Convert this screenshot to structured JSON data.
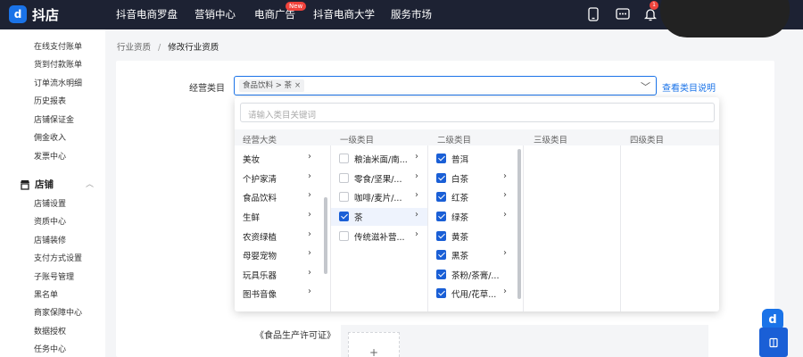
{
  "topnav": {
    "brand": "抖店",
    "items": [
      "抖音电商罗盘",
      "营销中心",
      "电商广告",
      "抖音电商大学",
      "服务市场"
    ],
    "new_badge": "New",
    "notify_badge": "1",
    "icons": [
      "phone-icon",
      "chat-icon",
      "bell-icon"
    ]
  },
  "sidebar": {
    "finance_items": [
      "在线支付账单",
      "货到付款账单",
      "订单流水明细",
      "历史报表",
      "店铺保证金",
      "佣金收入",
      "发票中心"
    ],
    "shop_group": "店铺",
    "shop_items": [
      "店铺设置",
      "资质中心",
      "店铺装修",
      "支付方式设置",
      "子账号管理",
      "黑名单",
      "商家保障中心",
      "数据授权",
      "任务中心"
    ]
  },
  "breadcrumb": {
    "parent": "行业资质",
    "separator": "/",
    "current": "修改行业资质"
  },
  "form": {
    "label": "经营类目",
    "selected_tag": "食品饮料 > 茶",
    "view_link": "查看类目说明",
    "license_label": "《食品生产许可证》",
    "upload_plus": "+"
  },
  "dropdown": {
    "search_placeholder": "请输入类目关键词",
    "columns": [
      "经营大类",
      "一级类目",
      "二级类目",
      "三级类目",
      "四级类目"
    ],
    "col1": [
      "美妆",
      "个护家清",
      "食品饮料",
      "生鲜",
      "农资绿植",
      "母婴宠物",
      "玩具乐器",
      "图书音像"
    ],
    "col2": [
      {
        "label": "粮油米面/南...",
        "checked": false,
        "selected": false
      },
      {
        "label": "零食/坚果/...",
        "checked": false,
        "selected": false
      },
      {
        "label": "咖啡/麦片/...",
        "checked": false,
        "selected": false
      },
      {
        "label": "茶",
        "checked": true,
        "selected": true
      },
      {
        "label": "传统滋补营...",
        "checked": false,
        "selected": false
      }
    ],
    "col3": [
      {
        "label": "普洱",
        "checked": true,
        "arrow": false
      },
      {
        "label": "白茶",
        "checked": true,
        "arrow": true
      },
      {
        "label": "红茶",
        "checked": true,
        "arrow": true
      },
      {
        "label": "绿茶",
        "checked": true,
        "arrow": true
      },
      {
        "label": "黄茶",
        "checked": true,
        "arrow": false
      },
      {
        "label": "黑茶",
        "checked": true,
        "arrow": true
      },
      {
        "label": "茶粉/茶膏/...",
        "checked": true,
        "arrow": false
      },
      {
        "label": "代用/花草...",
        "checked": true,
        "arrow": true
      }
    ]
  },
  "colors": {
    "nav_bg": "#1d2233",
    "accent": "#1a5fd6",
    "link": "#1a73e8",
    "badge": "#f0433c"
  }
}
